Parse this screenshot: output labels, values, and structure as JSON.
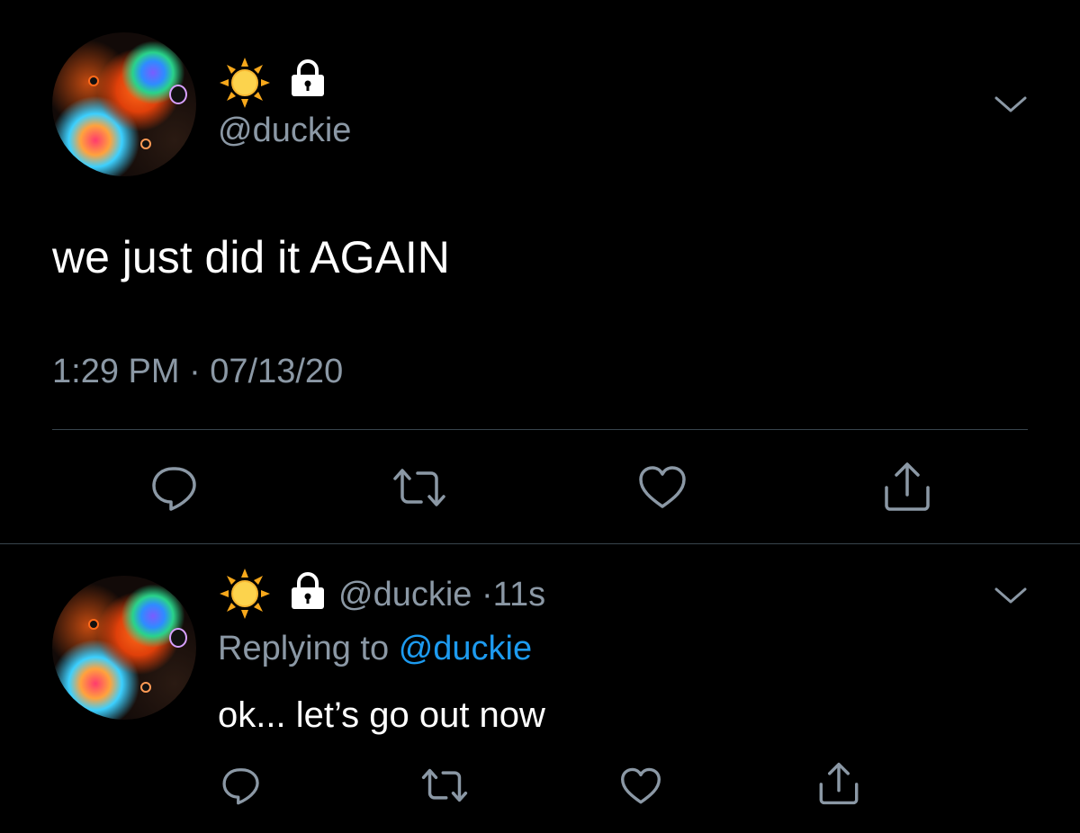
{
  "main_tweet": {
    "handle": "@duckie",
    "text": "we just did it AGAIN",
    "timestamp": "1:29 PM · 07/13/20"
  },
  "reply": {
    "handle": "@duckie",
    "separator": "·",
    "age": "11s",
    "replying_prefix": "Replying to",
    "replying_to": "@duckie",
    "text": "ok... let’s go out now"
  },
  "icons": {
    "name_emoji": "sun-icon",
    "protected": "lock-icon",
    "menu": "chevron-down-icon",
    "actions": [
      "reply-icon",
      "retweet-icon",
      "like-icon",
      "share-icon"
    ]
  },
  "colors": {
    "background": "#000000",
    "primary_text": "#ffffff",
    "secondary_text": "#8b98a5",
    "link": "#1d9bf0",
    "divider": "#38444d"
  }
}
